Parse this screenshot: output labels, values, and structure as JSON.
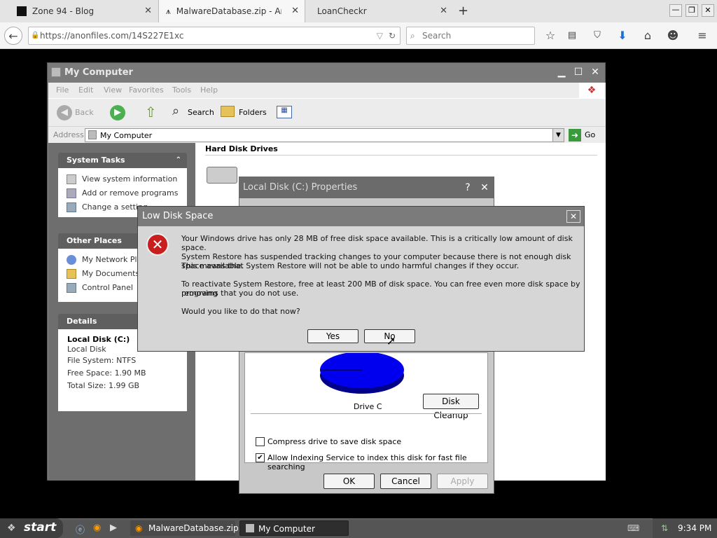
{
  "browser": {
    "tabs": [
      {
        "label": "Zone 94 - Blog",
        "active": false
      },
      {
        "label": "MalwareDatabase.zip - Anon…",
        "active": true
      },
      {
        "label": "LoanCheckr",
        "active": false
      }
    ],
    "url": "https://anonfiles.com/14S227E1xc",
    "search_placeholder": "Search"
  },
  "my_computer": {
    "title": "My Computer",
    "menu": [
      "File",
      "Edit",
      "View",
      "Favorites",
      "Tools",
      "Help"
    ],
    "toolbar": {
      "back": "Back",
      "search": "Search",
      "folders": "Folders"
    },
    "address_label": "Address",
    "address_value": "My Computer",
    "go_label": "Go",
    "system_tasks": {
      "title": "System Tasks",
      "items": [
        "View system information",
        "Add or remove programs",
        "Change a setting"
      ]
    },
    "other_places": {
      "title": "Other Places",
      "items": [
        "My Network Places",
        "My Documents",
        "Control Panel"
      ]
    },
    "details": {
      "title": "Details",
      "name": "Local Disk (C:)",
      "type": "Local Disk",
      "file_system": "File System: NTFS",
      "free_space": "Free Space: 1.90 MB",
      "total_size": "Total Size: 1.99 GB"
    },
    "section_header": "Hard Disk Drives"
  },
  "properties": {
    "title": "Local Disk (C:) Properties",
    "drive_label": "Drive C",
    "disk_cleanup": "Disk Cleanup",
    "compress_label": "Compress drive to save disk space",
    "compress_checked": false,
    "indexing_label": "Allow Indexing Service to index this disk for fast file searching",
    "indexing_checked": true,
    "ok": "OK",
    "cancel": "Cancel",
    "apply": "Apply",
    "pie_color": "#0000ee"
  },
  "low_disk": {
    "title": "Low Disk Space",
    "line1": "Your Windows drive has only 28 MB of free disk space available. This is a critically low amount of disk space.",
    "line2a": "System Restore has suspended tracking changes to your computer because there is not enough disk space available.",
    "line2b": "This means that System Restore will not be able to undo harmful changes if they occur.",
    "line3a": "To reactivate System Restore, free at least 200 MB of disk space. You can free even more disk space by removing",
    "line3b": "programs that you do not use.",
    "question": "Would you like to do that now?",
    "yes": "Yes",
    "no": "No"
  },
  "taskbar": {
    "start": "start",
    "items": [
      "MalwareDatabase.zip...",
      "My Computer"
    ],
    "clock": "9:34 PM"
  }
}
